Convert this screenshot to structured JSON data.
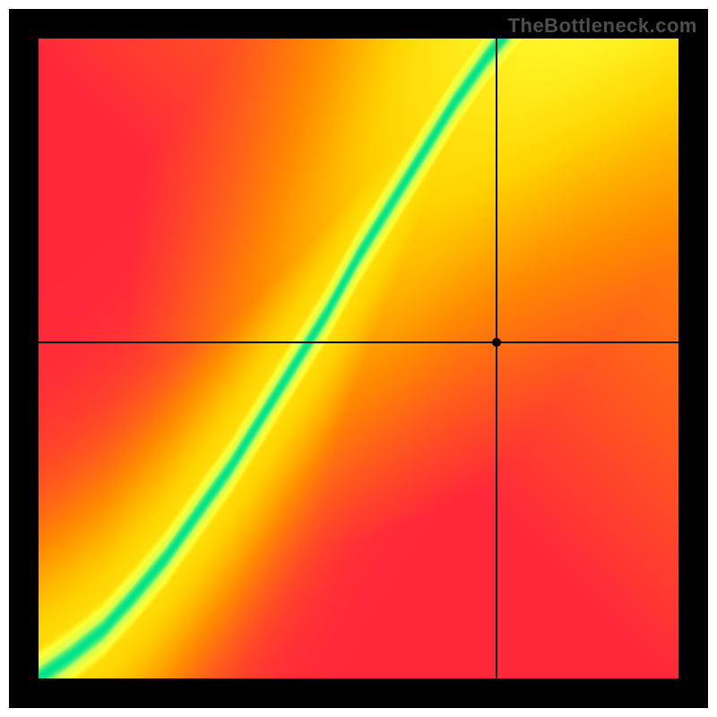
{
  "watermark": "TheBottleneck.com",
  "chart_data": {
    "type": "heatmap",
    "title": "",
    "xlabel": "",
    "ylabel": "",
    "xlim": [
      0,
      1
    ],
    "ylim": [
      0,
      1
    ],
    "grid": false,
    "colormap_stops": [
      {
        "t": 0.0,
        "color": "#ff1744"
      },
      {
        "t": 0.35,
        "color": "#ff8c00"
      },
      {
        "t": 0.55,
        "color": "#ffd500"
      },
      {
        "t": 0.75,
        "color": "#ffff33"
      },
      {
        "t": 0.92,
        "color": "#d4ff55"
      },
      {
        "t": 1.0,
        "color": "#00e38a"
      }
    ],
    "ridge": {
      "description": "optimal-match curve y(x) along which fitness=1",
      "points": [
        {
          "x": 0.0,
          "y": 0.0
        },
        {
          "x": 0.05,
          "y": 0.035
        },
        {
          "x": 0.1,
          "y": 0.075
        },
        {
          "x": 0.15,
          "y": 0.13
        },
        {
          "x": 0.2,
          "y": 0.19
        },
        {
          "x": 0.25,
          "y": 0.26
        },
        {
          "x": 0.3,
          "y": 0.33
        },
        {
          "x": 0.35,
          "y": 0.41
        },
        {
          "x": 0.4,
          "y": 0.49
        },
        {
          "x": 0.45,
          "y": 0.57
        },
        {
          "x": 0.5,
          "y": 0.66
        },
        {
          "x": 0.55,
          "y": 0.74
        },
        {
          "x": 0.6,
          "y": 0.82
        },
        {
          "x": 0.65,
          "y": 0.9
        },
        {
          "x": 0.7,
          "y": 0.97
        },
        {
          "x": 0.725,
          "y": 1.0
        }
      ],
      "width_frac": 0.045
    },
    "fitness_formula": "gaussian falloff from ridge in y, modulated by directional background gradient",
    "crosshair": {
      "x": 0.715,
      "y": 0.525
    },
    "marker": {
      "x": 0.715,
      "y": 0.525
    }
  }
}
